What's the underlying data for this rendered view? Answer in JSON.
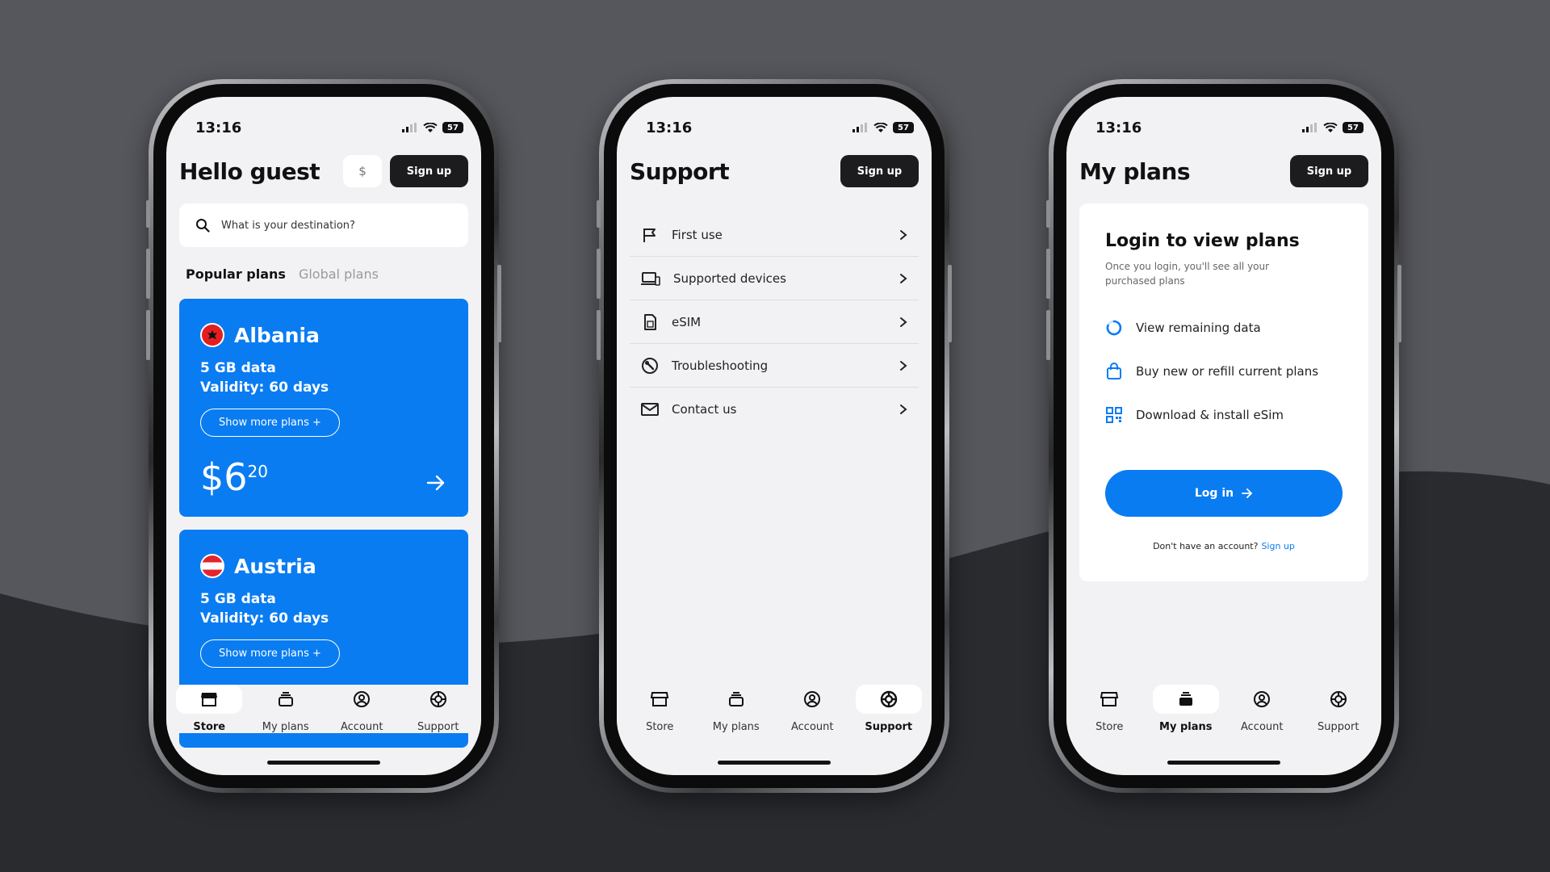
{
  "status": {
    "time": "13:16",
    "battery": "57"
  },
  "store": {
    "title": "Hello guest",
    "currency": "$",
    "signup": "Sign up",
    "search_placeholder": "What is your destination?",
    "tabs": {
      "popular": "Popular plans",
      "global": "Global plans"
    },
    "cards": [
      {
        "country": "Albania",
        "data": "5 GB data",
        "validity": "Validity: 60 days",
        "more": "Show more plans +",
        "price_main": "$6",
        "price_cents": "20"
      },
      {
        "country": "Austria",
        "data": "5 GB data",
        "validity": "Validity: 60 days",
        "more": "Show more plans +"
      }
    ]
  },
  "support": {
    "title": "Support",
    "signup": "Sign up",
    "items": [
      {
        "label": "First use",
        "icon": "flag-icon"
      },
      {
        "label": "Supported devices",
        "icon": "devices-icon"
      },
      {
        "label": "eSIM",
        "icon": "sim-icon"
      },
      {
        "label": "Troubleshooting",
        "icon": "wrench-icon"
      },
      {
        "label": "Contact us",
        "icon": "mail-icon"
      }
    ]
  },
  "plans": {
    "title": "My plans",
    "signup": "Sign up",
    "login_title": "Login to view plans",
    "login_sub": "Once you login, you'll see all your purchased plans",
    "features": [
      {
        "label": "View remaining data",
        "icon": "circle-progress-icon"
      },
      {
        "label": "Buy new or refill current plans",
        "icon": "shopping-bag-icon"
      },
      {
        "label": "Download & install eSim",
        "icon": "qr-code-icon"
      }
    ],
    "login_btn": "Log in",
    "no_account": "Don't have an account?",
    "signup_link": "Sign up"
  },
  "nav": {
    "store": "Store",
    "plans": "My plans",
    "account": "Account",
    "support": "Support"
  },
  "colors": {
    "accent": "#0a7cf2",
    "dark_button": "#1c1c1e",
    "screen_bg": "#f2f2f4",
    "backdrop": "#56575c",
    "wave": "#2a2b2f"
  }
}
